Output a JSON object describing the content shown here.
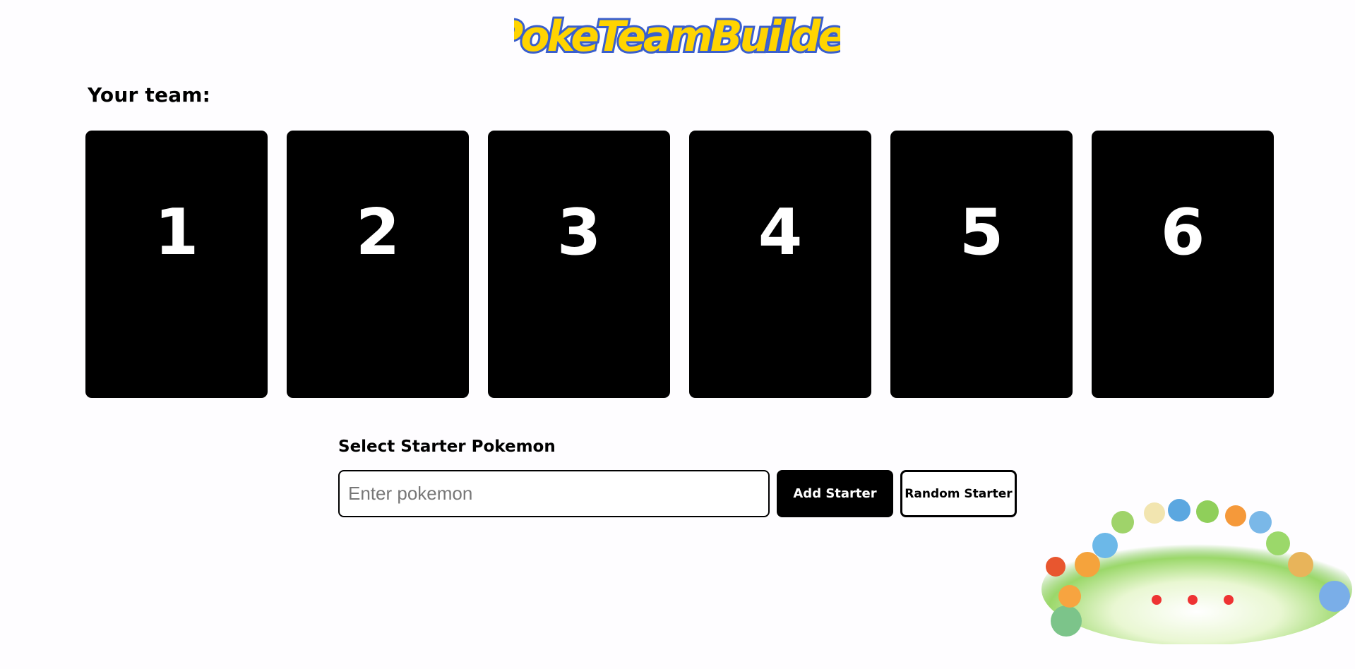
{
  "header": {
    "logo_text": "PokeTeamBuilder"
  },
  "team": {
    "heading": "Your team:",
    "slots": [
      "1",
      "2",
      "3",
      "4",
      "5",
      "6"
    ]
  },
  "starter": {
    "label": "Select Starter Pokemon",
    "input_placeholder": "Enter pokemon",
    "input_value": "",
    "add_button": "Add Starter",
    "random_button": "Random Starter"
  },
  "colors": {
    "background": "#fefdff",
    "slot": "#000000",
    "slot_text": "#ffffff",
    "logo_fill": "#ffd400",
    "logo_outline": "#3a5fcd"
  },
  "icons": {
    "logo": "poke-team-builder-logo",
    "starter_art": "starter-pokemon-group-illustration"
  }
}
